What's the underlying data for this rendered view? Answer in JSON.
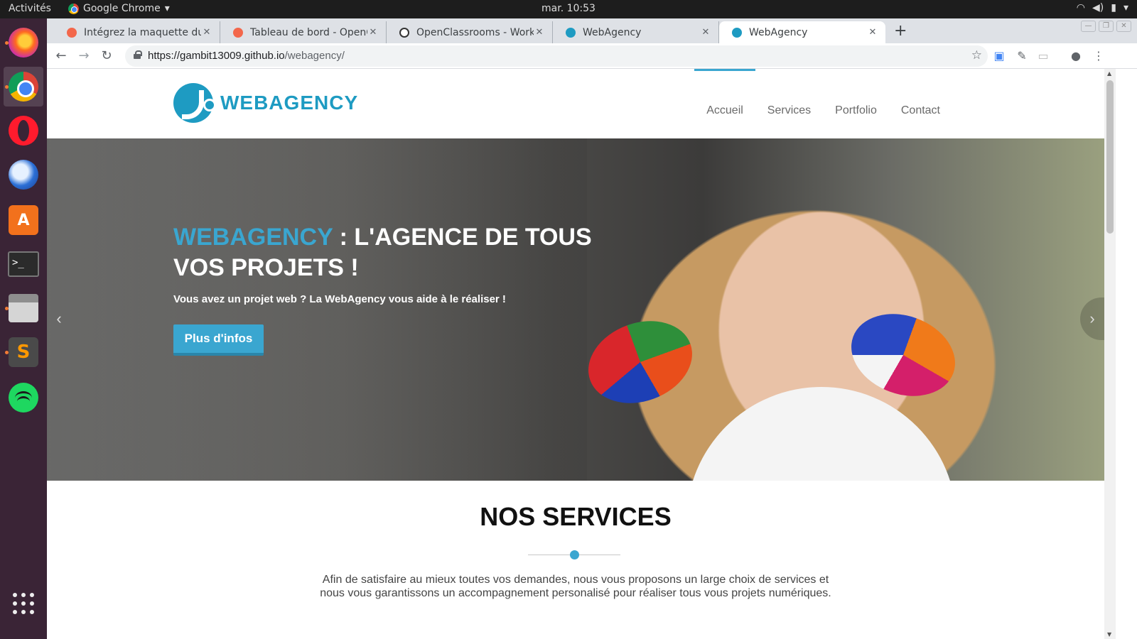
{
  "system": {
    "activities": "Activités",
    "app_name": "Google Chrome",
    "clock": "mar. 10:53"
  },
  "dock": {
    "apps": [
      "firefox",
      "chrome",
      "opera",
      "thunderbird",
      "software-center",
      "terminal",
      "files",
      "sublime-text",
      "spotify",
      "show-applications"
    ]
  },
  "browser": {
    "tabs": [
      {
        "label": "Intégrez la maquette du s",
        "favicon": "openclassrooms",
        "active": false
      },
      {
        "label": "Tableau de bord - OpenCla",
        "favicon": "openclassrooms",
        "active": false
      },
      {
        "label": "OpenClassrooms - Workp",
        "favicon": "wordpress",
        "active": false
      },
      {
        "label": "WebAgency",
        "favicon": "webagency",
        "active": false
      },
      {
        "label": "WebAgency",
        "favicon": "webagency",
        "active": true
      }
    ],
    "url_host": "https://gambit13009.github.io",
    "url_path": "/webagency/"
  },
  "site": {
    "logo_text": "WEBAGENCY",
    "nav": [
      {
        "label": "Accueil",
        "active": true
      },
      {
        "label": "Services",
        "active": false
      },
      {
        "label": "Portfolio",
        "active": false
      },
      {
        "label": "Contact",
        "active": false
      }
    ],
    "hero": {
      "title_brand": "WEBAGENCY",
      "title_rest": " : L'AGENCE DE TOUS VOS PROJETS !",
      "subtitle": "Vous avez un projet web ? La WebAgency vous aide à le réaliser !",
      "button": "Plus d'infos"
    },
    "services": {
      "title": "NOS SERVICES",
      "text": "Afin de satisfaire au mieux toutes vos demandes, nous vous proposons un large choix de services et nous vous garantissons un accompagnement personalisé pour réaliser tous vous projets numériques."
    }
  },
  "colors": {
    "accent": "#3aa6d0",
    "logo": "#1e9bc2",
    "dock_bg": "#3a2436"
  }
}
